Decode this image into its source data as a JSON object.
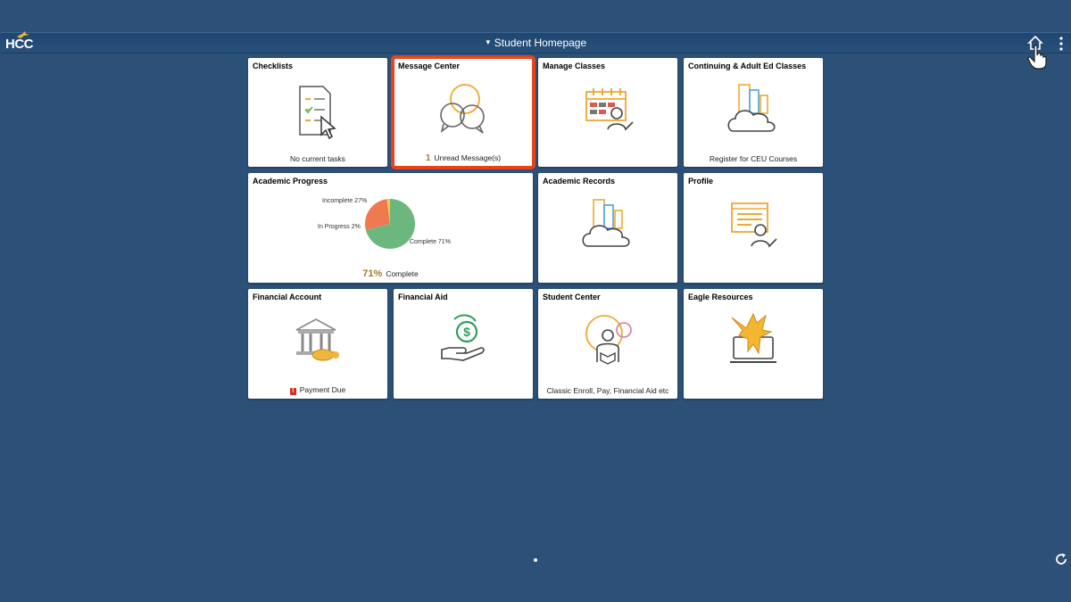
{
  "header": {
    "logo_text": "HCC",
    "title": "Student Homepage"
  },
  "icons": {
    "caret": "caret-down-icon",
    "home": "home-icon",
    "more": "vertical-dots-icon",
    "cursor": "hand-pointer-icon",
    "refresh": "refresh-icon"
  },
  "tiles": {
    "checklists": {
      "title": "Checklists",
      "footer": "No current tasks",
      "icon": "checklist-clipboard-icon"
    },
    "message_center": {
      "title": "Message Center",
      "count": "1",
      "footer": "Unread Message(s)",
      "icon": "chat-bubbles-icon"
    },
    "manage_classes": {
      "title": "Manage Classes",
      "icon": "calendar-person-icon"
    },
    "continuing_ed": {
      "title": "Continuing & Adult Ed Classes",
      "footer": "Register for CEU Courses",
      "icon": "cloud-buildings-icon"
    },
    "academic_progress": {
      "title": "Academic Progress",
      "percent": "71%",
      "footer": "Complete",
      "labels": {
        "incomplete": "Incomplete 27%",
        "in_progress": "In Progress 2%",
        "complete": "Complete 71%"
      }
    },
    "academic_records": {
      "title": "Academic Records",
      "icon": "cloud-buildings-icon"
    },
    "profile": {
      "title": "Profile",
      "icon": "profile-card-icon"
    },
    "financial_account": {
      "title": "Financial Account",
      "footer": "Payment Due",
      "warning": "!",
      "icon": "bank-money-icon"
    },
    "financial_aid": {
      "title": "Financial Aid",
      "icon": "hand-dollar-icon"
    },
    "student_center": {
      "title": "Student Center",
      "footer": "Classic Enroll, Pay, Financial Aid etc",
      "icon": "student-reading-icon"
    },
    "eagle_resources": {
      "title": "Eagle Resources",
      "icon": "eagle-laptop-icon"
    }
  },
  "chart_data": {
    "type": "pie",
    "slices": [
      {
        "label": "Complete",
        "value": 71,
        "color": "#6cb77e"
      },
      {
        "label": "Incomplete",
        "value": 27,
        "color": "#ef7a52"
      },
      {
        "label": "In Progress",
        "value": 2,
        "color": "#f2c94c"
      }
    ]
  },
  "colors": {
    "background": "#2c5077",
    "selection": "#e8441a",
    "accent_gold": "#a27b2c",
    "icon_orange": "#f0a830"
  }
}
